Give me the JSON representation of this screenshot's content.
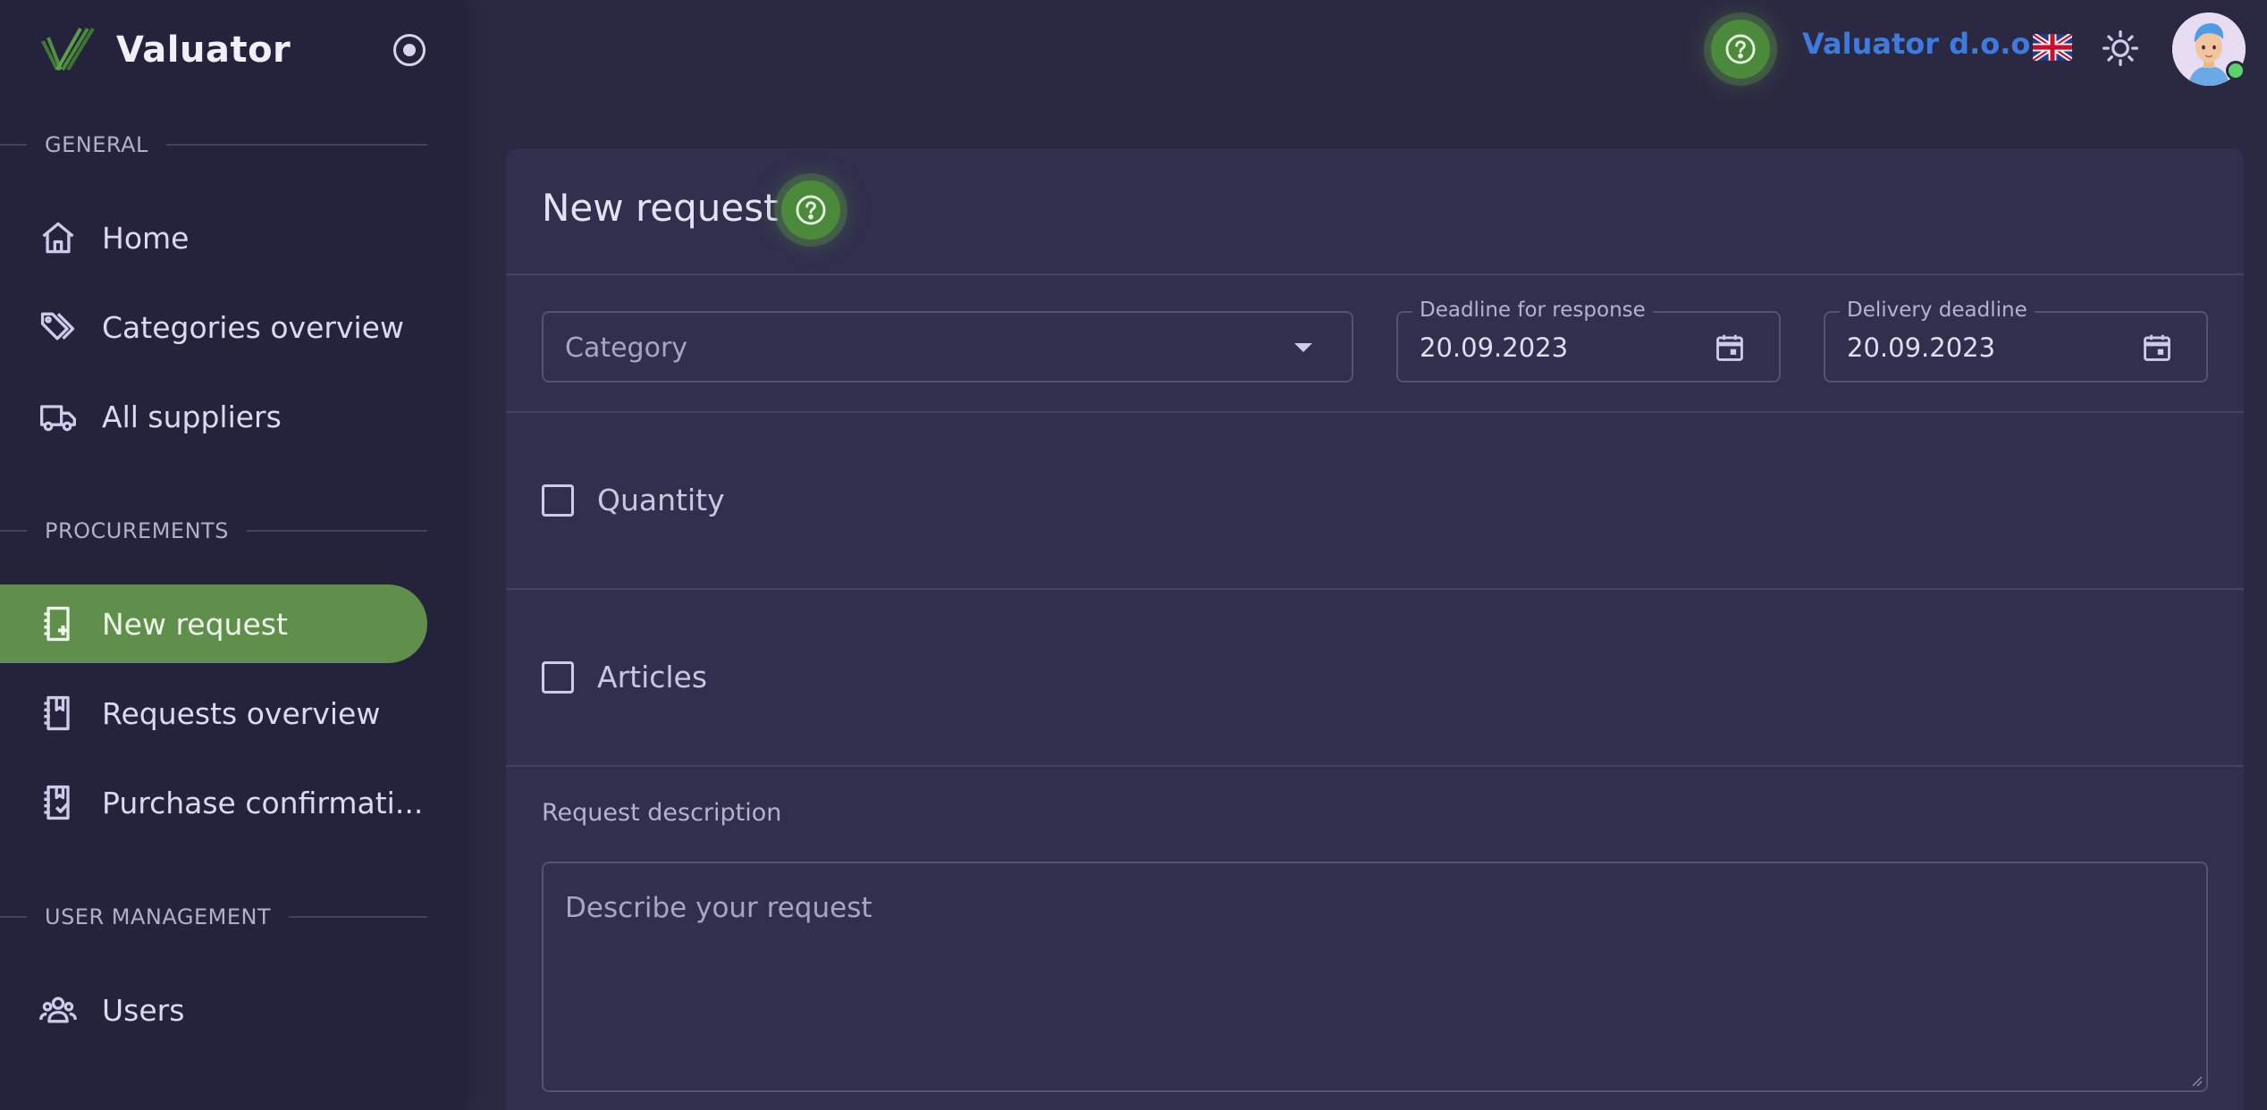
{
  "brand": {
    "name": "Valuator"
  },
  "sidebar": {
    "sections": [
      {
        "label": "GENERAL"
      },
      {
        "label": "PROCUREMENTS"
      },
      {
        "label": "USER MANAGEMENT"
      }
    ],
    "items": [
      {
        "label": "Home",
        "icon": "home-icon"
      },
      {
        "label": "Categories overview",
        "icon": "tags-icon"
      },
      {
        "label": "All suppliers",
        "icon": "truck-icon"
      },
      {
        "label": "New request",
        "icon": "notebook-plus-icon",
        "active": true
      },
      {
        "label": "Requests overview",
        "icon": "notebook-icon"
      },
      {
        "label": "Purchase confirmati...",
        "icon": "notebook-check-icon"
      },
      {
        "label": "Users",
        "icon": "users-icon"
      }
    ]
  },
  "topbar": {
    "company": "Valuator d.o.o.",
    "language": "English (UK flag)"
  },
  "page": {
    "title": "New request",
    "category": {
      "placeholder": "Category"
    },
    "deadline_response": {
      "label": "Deadline for response",
      "value": "20.09.2023"
    },
    "delivery_deadline": {
      "label": "Delivery deadline",
      "value": "20.09.2023"
    },
    "quantity_label": "Quantity",
    "articles_label": "Articles",
    "description_label": "Request description",
    "description_placeholder": "Describe your request"
  },
  "colors": {
    "accent": "#5f8f4b",
    "company_link": "#3e7bde",
    "background": "#2b2942",
    "sidebar": "#25233b",
    "card": "#312f4d"
  }
}
